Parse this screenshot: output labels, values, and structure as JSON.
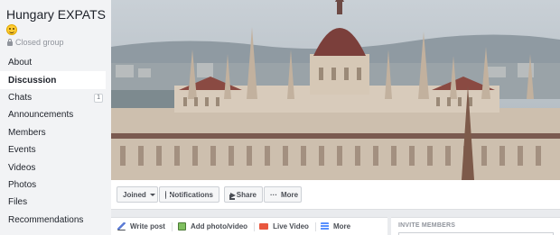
{
  "group": {
    "name": "Hungary EXPATS",
    "privacy": "Closed group",
    "emoji_icon": "smiling-face-emoji"
  },
  "nav": {
    "items": [
      {
        "label": "About",
        "active": false
      },
      {
        "label": "Discussion",
        "active": true
      },
      {
        "label": "Chats",
        "active": false,
        "badge": "1"
      },
      {
        "label": "Announcements",
        "active": false
      },
      {
        "label": "Members",
        "active": false
      },
      {
        "label": "Events",
        "active": false
      },
      {
        "label": "Videos",
        "active": false
      },
      {
        "label": "Photos",
        "active": false
      },
      {
        "label": "Files",
        "active": false
      },
      {
        "label": "Recommendations",
        "active": false
      }
    ]
  },
  "actions": {
    "joined": "Joined",
    "notifications": "Notifications",
    "share": "Share",
    "more": "More",
    "more_prefix": "···"
  },
  "composer": {
    "write_post": "Write post",
    "add_photo": "Add photo/video",
    "live_video": "Live Video",
    "more": "More"
  },
  "invite": {
    "label": "INVITE MEMBERS"
  },
  "colors": {
    "sidebar_bg": "#f2f3f5",
    "page_bg": "#e9ebee",
    "text": "#1d2129",
    "muted": "#90949c"
  }
}
